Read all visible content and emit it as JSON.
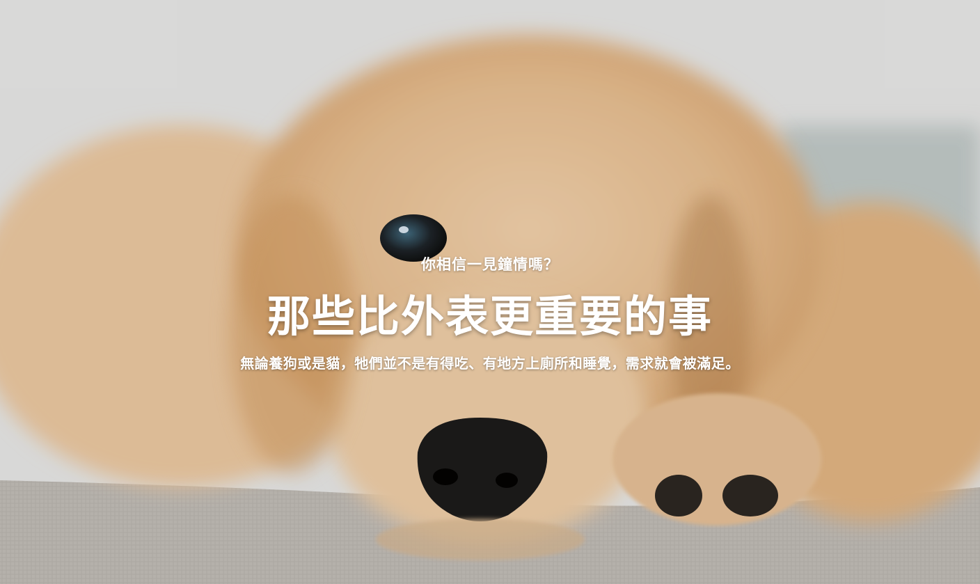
{
  "hero": {
    "eyebrow": "你相信一見鐘情嗎？",
    "title": "那些比外表更重要的事",
    "subtitle": "無論養狗或是貓，牠們並不是有得吃、有地方上廁所和睡覺，需求就會被滿足。",
    "text_color": "#ffffff"
  }
}
